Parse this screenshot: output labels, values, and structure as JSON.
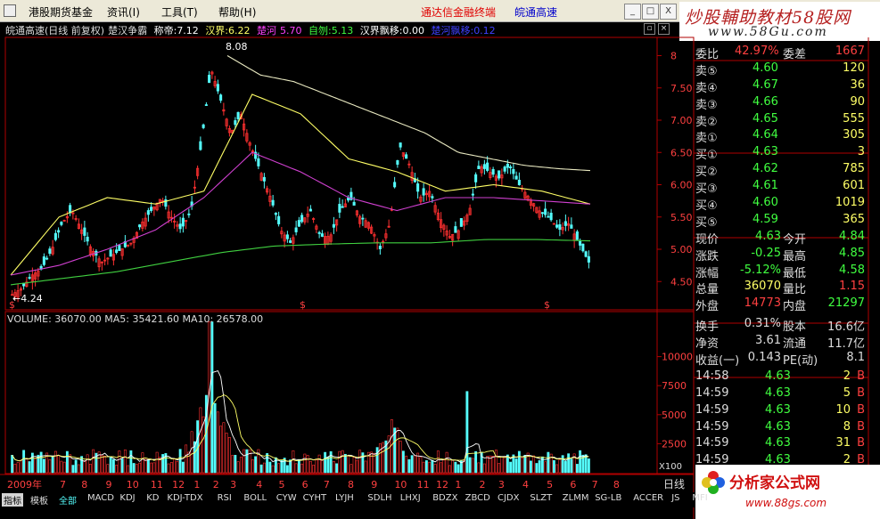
{
  "menubar": {
    "items": [
      "港股期货基金",
      "资讯(I)",
      "工具(T)",
      "帮助(H)"
    ],
    "brand_red": "通达信金融终端",
    "brand_blue": "皖通高速",
    "buttons": [
      "_",
      "□",
      "X"
    ]
  },
  "watermark_top": {
    "line1": "炒股輔助教材58股网",
    "line2": "www.58Gu.com"
  },
  "chart_header": {
    "title": "皖通高速(日线 前复权)",
    "indicator": "楚汉争霸",
    "v1_label": "称帝:",
    "v1": "7.12",
    "v2_label": "汉界:",
    "v2": "6.22",
    "v3_label": "楚河",
    "v3": "5.70",
    "v4_label": "自刎:",
    "v4": "5.13",
    "v5_label": "汉界飘移:",
    "v5": "0.00",
    "v6_label": "楚河飘移:",
    "v6": "0.12",
    "colors": {
      "v1": "#ffffff",
      "v2": "#ffff66",
      "v3": "#ff40ff",
      "v4": "#40ff40",
      "v5": "#ffffff",
      "v6": "#4040ff"
    }
  },
  "price_axis": {
    "ticks": [
      "8",
      "7.50",
      "7.00",
      "6.50",
      "6.00",
      "5.50",
      "5.00",
      "4.50"
    ],
    "high_label": "8.08",
    "low_label": "4.24"
  },
  "volume": {
    "header": "VOLUME: 36070.00  MA5: 35421.60  MA10: 26578.00",
    "ticks": [
      "10000",
      "7500",
      "5000",
      "2500"
    ],
    "unit": "X100"
  },
  "x_axis": {
    "labels": [
      "2009年",
      "7",
      "8",
      "9",
      "10",
      "11",
      "12",
      "1",
      "2",
      "3",
      "4",
      "5",
      "6",
      "7",
      "8",
      "9",
      "10",
      "11",
      "12",
      "1",
      "2",
      "3",
      "4",
      "5",
      "6",
      "7",
      "8"
    ],
    "period": "日线"
  },
  "chart_data": [
    {
      "type": "candlestick",
      "title": "皖通高速(日线 前复权)",
      "ylim": [
        4.2,
        8.2
      ],
      "yticks": [
        4.5,
        5.0,
        5.5,
        6.0,
        6.5,
        7.0,
        7.5,
        8.0
      ],
      "annotations": [
        {
          "text": "8.08",
          "value": 8.08
        },
        {
          "text": "4.24",
          "value": 4.24
        }
      ],
      "close_path": [
        4.3,
        4.4,
        4.6,
        4.7,
        5.0,
        5.4,
        5.6,
        5.3,
        5.0,
        4.8,
        4.9,
        5.0,
        5.1,
        5.4,
        5.6,
        5.8,
        5.5,
        5.3,
        5.6,
        6.6,
        7.8,
        7.3,
        6.8,
        7.1,
        6.6,
        6.2,
        5.8,
        5.3,
        5.1,
        5.4,
        5.6,
        5.2,
        5.2,
        5.6,
        5.8,
        5.5,
        5.4,
        5.0,
        5.4,
        6.6,
        6.3,
        5.8,
        5.9,
        5.5,
        5.2,
        5.3,
        5.6,
        6.3,
        6.2,
        6.1,
        6.3,
        6.0,
        5.8,
        5.6,
        5.5,
        5.3,
        5.4,
        5.1,
        4.8
      ],
      "series": [
        {
          "name": "称帝",
          "color": "#e8e8c0",
          "values": [
            8.0,
            7.7,
            7.6,
            7.4,
            7.2,
            7.0,
            6.8,
            6.5,
            6.4,
            6.3,
            6.25,
            6.22
          ]
        },
        {
          "name": "汉界",
          "color": "#ffff66",
          "values": [
            4.6,
            5.5,
            5.8,
            5.7,
            5.9,
            7.4,
            7.1,
            6.4,
            6.2,
            5.9,
            6.0,
            5.9,
            5.7
          ]
        },
        {
          "name": "楚河",
          "color": "#d040d0",
          "values": [
            4.6,
            4.75,
            5.0,
            5.3,
            5.8,
            6.5,
            6.2,
            5.8,
            5.6,
            5.8,
            5.8,
            5.75,
            5.7
          ]
        },
        {
          "name": "自刎",
          "color": "#40d040",
          "values": [
            4.45,
            4.55,
            4.65,
            4.8,
            4.95,
            5.05,
            5.08,
            5.1,
            5.1,
            5.15,
            5.15,
            5.13
          ]
        }
      ]
    },
    {
      "type": "bar",
      "title": "VOLUME",
      "ylim": [
        0,
        12500
      ],
      "yticks": [
        2500,
        5000,
        7500,
        10000
      ],
      "peaks": [
        {
          "index": "2010-01",
          "value": 13000
        },
        {
          "index": "2010-12",
          "value": 7000
        }
      ],
      "ma5": 35421.6,
      "ma10": 26578.0
    }
  ],
  "quote": {
    "weibi_label": "委比",
    "weibi": "42.97%",
    "weicha_label": "委差",
    "weicha": "1667",
    "asks": [
      {
        "label": "卖⑤",
        "price": "4.60",
        "vol": "120"
      },
      {
        "label": "卖④",
        "price": "4.67",
        "vol": "36"
      },
      {
        "label": "卖③",
        "price": "4.66",
        "vol": "90"
      },
      {
        "label": "卖②",
        "price": "4.65",
        "vol": "555"
      },
      {
        "label": "卖①",
        "price": "4.64",
        "vol": "305"
      }
    ],
    "bids": [
      {
        "label": "买①",
        "price": "4.63",
        "vol": "3"
      },
      {
        "label": "买②",
        "price": "4.62",
        "vol": "785"
      },
      {
        "label": "买③",
        "price": "4.61",
        "vol": "601"
      },
      {
        "label": "买④",
        "price": "4.60",
        "vol": "1019"
      },
      {
        "label": "买⑤",
        "price": "4.59",
        "vol": "365"
      }
    ],
    "stats": [
      {
        "l1": "现价",
        "v1": "4.63",
        "c1": "#40ff40",
        "l2": "今开",
        "v2": "4.84",
        "c2": "#40ff40"
      },
      {
        "l1": "涨跌",
        "v1": "-0.25",
        "c1": "#40ff40",
        "l2": "最高",
        "v2": "4.85",
        "c2": "#40ff40"
      },
      {
        "l1": "涨幅",
        "v1": "-5.12%",
        "c1": "#40ff40",
        "l2": "最低",
        "v2": "4.58",
        "c2": "#40ff40"
      },
      {
        "l1": "总量",
        "v1": "36070",
        "c1": "#ffff66",
        "l2": "量比",
        "v2": "1.15",
        "c2": "#ff4040"
      },
      {
        "l1": "外盘",
        "v1": "14773",
        "c1": "#ff4040",
        "l2": "内盘",
        "v2": "21297",
        "c2": "#40ff40"
      }
    ],
    "fund": [
      {
        "l1": "换手",
        "v1": "0.31%",
        "l2": "股本",
        "v2": "16.6亿"
      },
      {
        "l1": "净资",
        "v1": "3.61",
        "l2": "流通",
        "v2": "11.7亿"
      },
      {
        "l1": "收益(一)",
        "v1": "0.143",
        "l2": "PE(动)",
        "v2": "8.1"
      }
    ],
    "ticks": [
      {
        "time": "14:58",
        "price": "4.63",
        "vol": "2",
        "bs": "B"
      },
      {
        "time": "14:59",
        "price": "4.63",
        "vol": "5",
        "bs": "B"
      },
      {
        "time": "14:59",
        "price": "4.63",
        "vol": "10",
        "bs": "B"
      },
      {
        "time": "14:59",
        "price": "4.63",
        "vol": "8",
        "bs": "B"
      },
      {
        "time": "14:59",
        "price": "4.63",
        "vol": "31",
        "bs": "B"
      },
      {
        "time": "14:59",
        "price": "4.63",
        "vol": "2",
        "bs": "B"
      }
    ]
  },
  "watermark_bottom": {
    "line1": "分析家公式网",
    "line2": "www.88gs.com"
  },
  "tabs": [
    "指标",
    "模板",
    "全部",
    "MACD",
    "KDJ",
    "KD",
    "KDJ-TDX",
    "RSI",
    "BOLL",
    "CYW",
    "CYHT",
    "LYJH",
    "SDLH",
    "LHXJ",
    "BDZX",
    "ZBCD",
    "CJDX",
    "SLZT",
    "ZLMM",
    "SG-LB",
    "ACCER",
    "JS",
    "MFI"
  ]
}
